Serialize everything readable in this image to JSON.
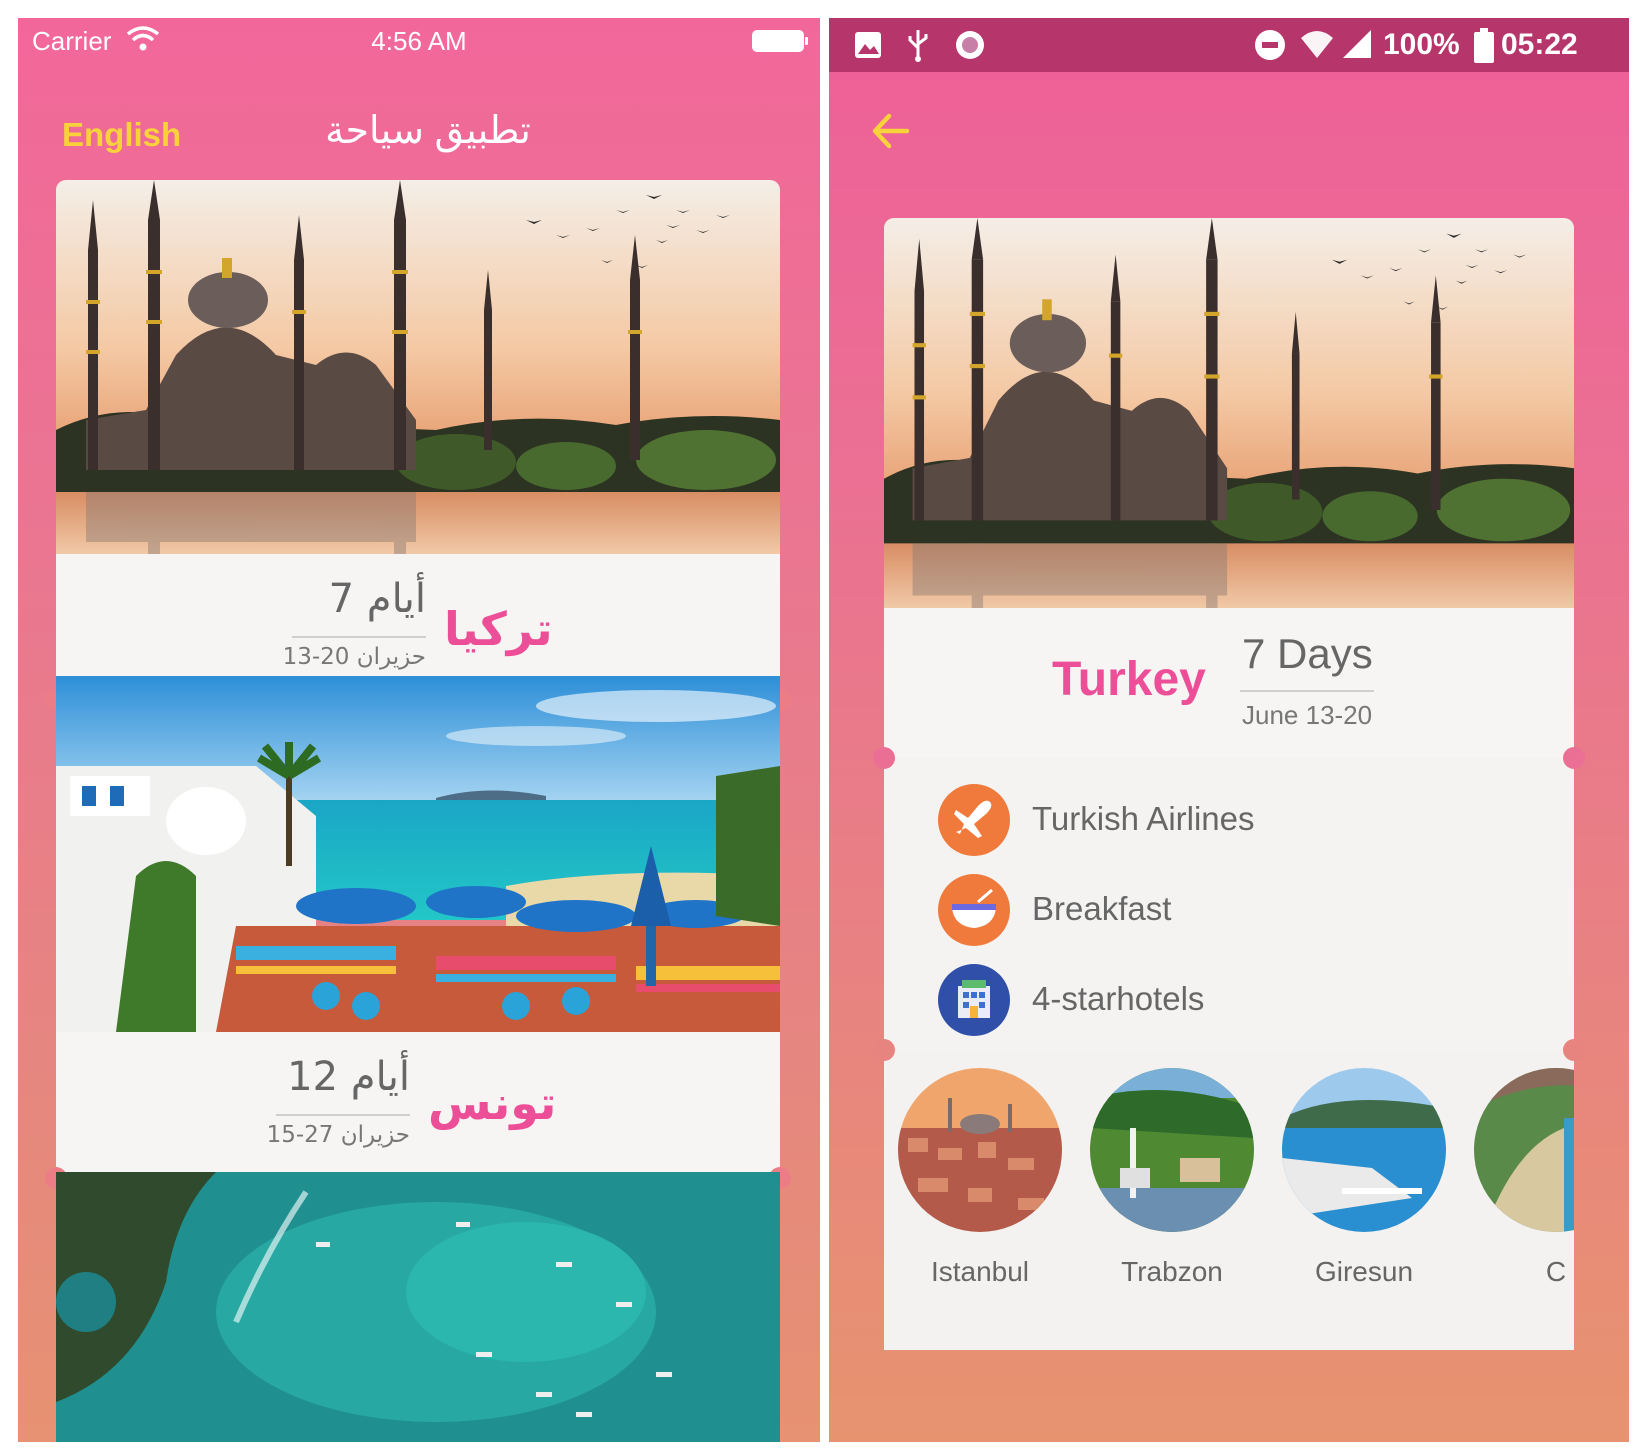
{
  "left_screen": {
    "status_bar": {
      "carrier": "Carrier",
      "time": "4:56 AM"
    },
    "header": {
      "language_button": "English",
      "title": "تطبيق سياحة"
    },
    "trips": [
      {
        "country": "تركيا",
        "days": "7 أيام",
        "dates": "13-20 حزيران"
      },
      {
        "country": "تونس",
        "days": "12 أيام",
        "dates": "15-27 حزيران"
      }
    ]
  },
  "right_screen": {
    "status_bar": {
      "battery_percent": "100%",
      "time": "05:22"
    },
    "trip": {
      "country": "Turkey",
      "days": "7 Days",
      "dates": "June 13-20"
    },
    "features": [
      {
        "icon": "airplane-icon",
        "label": "Turkish Airlines"
      },
      {
        "icon": "breakfast-bowl-icon",
        "label": "Breakfast"
      },
      {
        "icon": "hotel-icon",
        "label": "4-starhotels"
      }
    ],
    "cities": [
      {
        "name": "Istanbul"
      },
      {
        "name": "Trabzon"
      },
      {
        "name": "Giresun"
      },
      {
        "name": "C"
      }
    ]
  },
  "colors": {
    "accent_pink": "#ec4f97",
    "language_yellow": "#f7d23a",
    "feature_orange": "#f07a3c",
    "feature_blue": "#2f4fa8"
  }
}
